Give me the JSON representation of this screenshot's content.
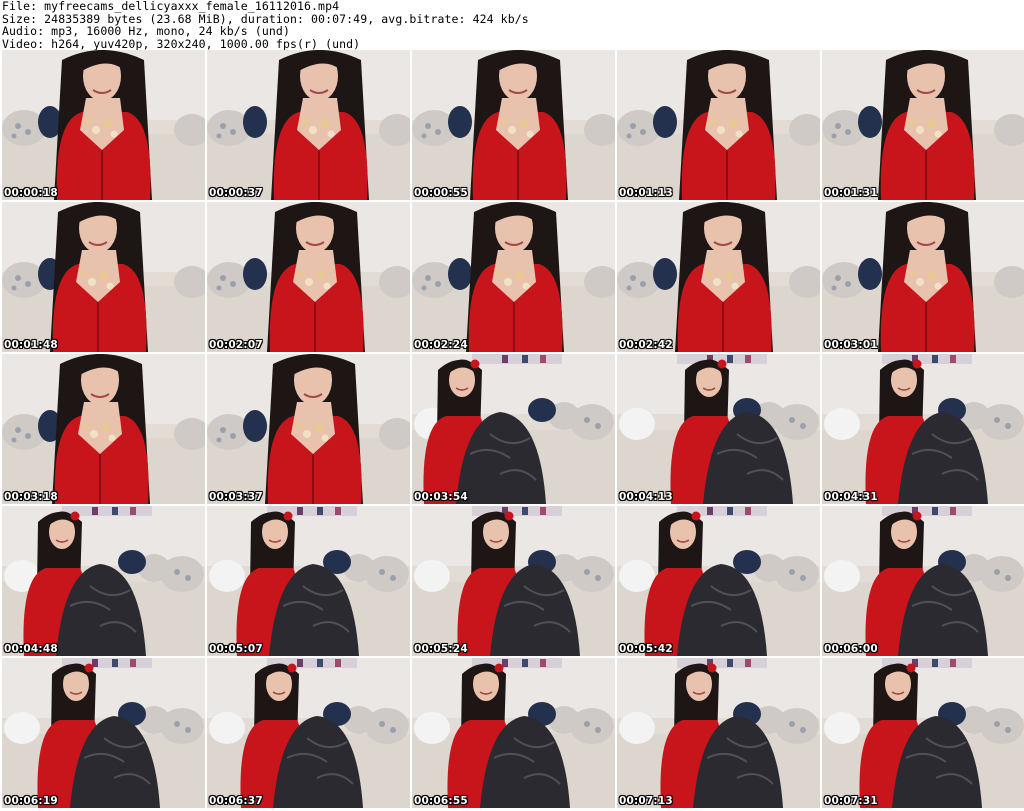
{
  "header": {
    "file_line": "File: myfreecams_dellicyaxxx_female_16112016.mp4",
    "size_line": "Size: 24835389 bytes (23.68 MiB), duration: 00:07:49, avg.bitrate: 424 kb/s",
    "audio_line": "Audio: mp3, 16000 Hz, mono, 24 kb/s (und)",
    "video_line": "Video: h264, yuv420p, 320x240, 1000.00 fps(r) (und)"
  },
  "thumbnails": [
    {
      "timestamp": "00:00:18",
      "scene": "closeup"
    },
    {
      "timestamp": "00:00:37",
      "scene": "closeup"
    },
    {
      "timestamp": "00:00:55",
      "scene": "closeup"
    },
    {
      "timestamp": "00:01:13",
      "scene": "closeup"
    },
    {
      "timestamp": "00:01:31",
      "scene": "closeup"
    },
    {
      "timestamp": "00:01:48",
      "scene": "closeup"
    },
    {
      "timestamp": "00:02:07",
      "scene": "closeup"
    },
    {
      "timestamp": "00:02:24",
      "scene": "closeup"
    },
    {
      "timestamp": "00:02:42",
      "scene": "closeup"
    },
    {
      "timestamp": "00:03:01",
      "scene": "closeup"
    },
    {
      "timestamp": "00:03:18",
      "scene": "closeup"
    },
    {
      "timestamp": "00:03:37",
      "scene": "closeup"
    },
    {
      "timestamp": "00:03:54",
      "scene": "seated"
    },
    {
      "timestamp": "00:04:13",
      "scene": "seated"
    },
    {
      "timestamp": "00:04:31",
      "scene": "seated"
    },
    {
      "timestamp": "00:04:48",
      "scene": "seated"
    },
    {
      "timestamp": "00:05:07",
      "scene": "seated"
    },
    {
      "timestamp": "00:05:24",
      "scene": "seated"
    },
    {
      "timestamp": "00:05:42",
      "scene": "seated"
    },
    {
      "timestamp": "00:06:00",
      "scene": "seated"
    },
    {
      "timestamp": "00:06:19",
      "scene": "seated"
    },
    {
      "timestamp": "00:06:37",
      "scene": "seated"
    },
    {
      "timestamp": "00:06:55",
      "scene": "seated"
    },
    {
      "timestamp": "00:07:13",
      "scene": "seated"
    },
    {
      "timestamp": "00:07:31",
      "scene": "seated"
    }
  ],
  "colors": {
    "dress": "#c8141b",
    "hair": "#1e1614",
    "skin": "#e9c2ae",
    "sofa": "#ddd6cf",
    "wall": "#ebe7e4",
    "stockings": "#2a2a30",
    "pillow_navy": "#23314f",
    "pillow_floral": "#cfcac6"
  }
}
